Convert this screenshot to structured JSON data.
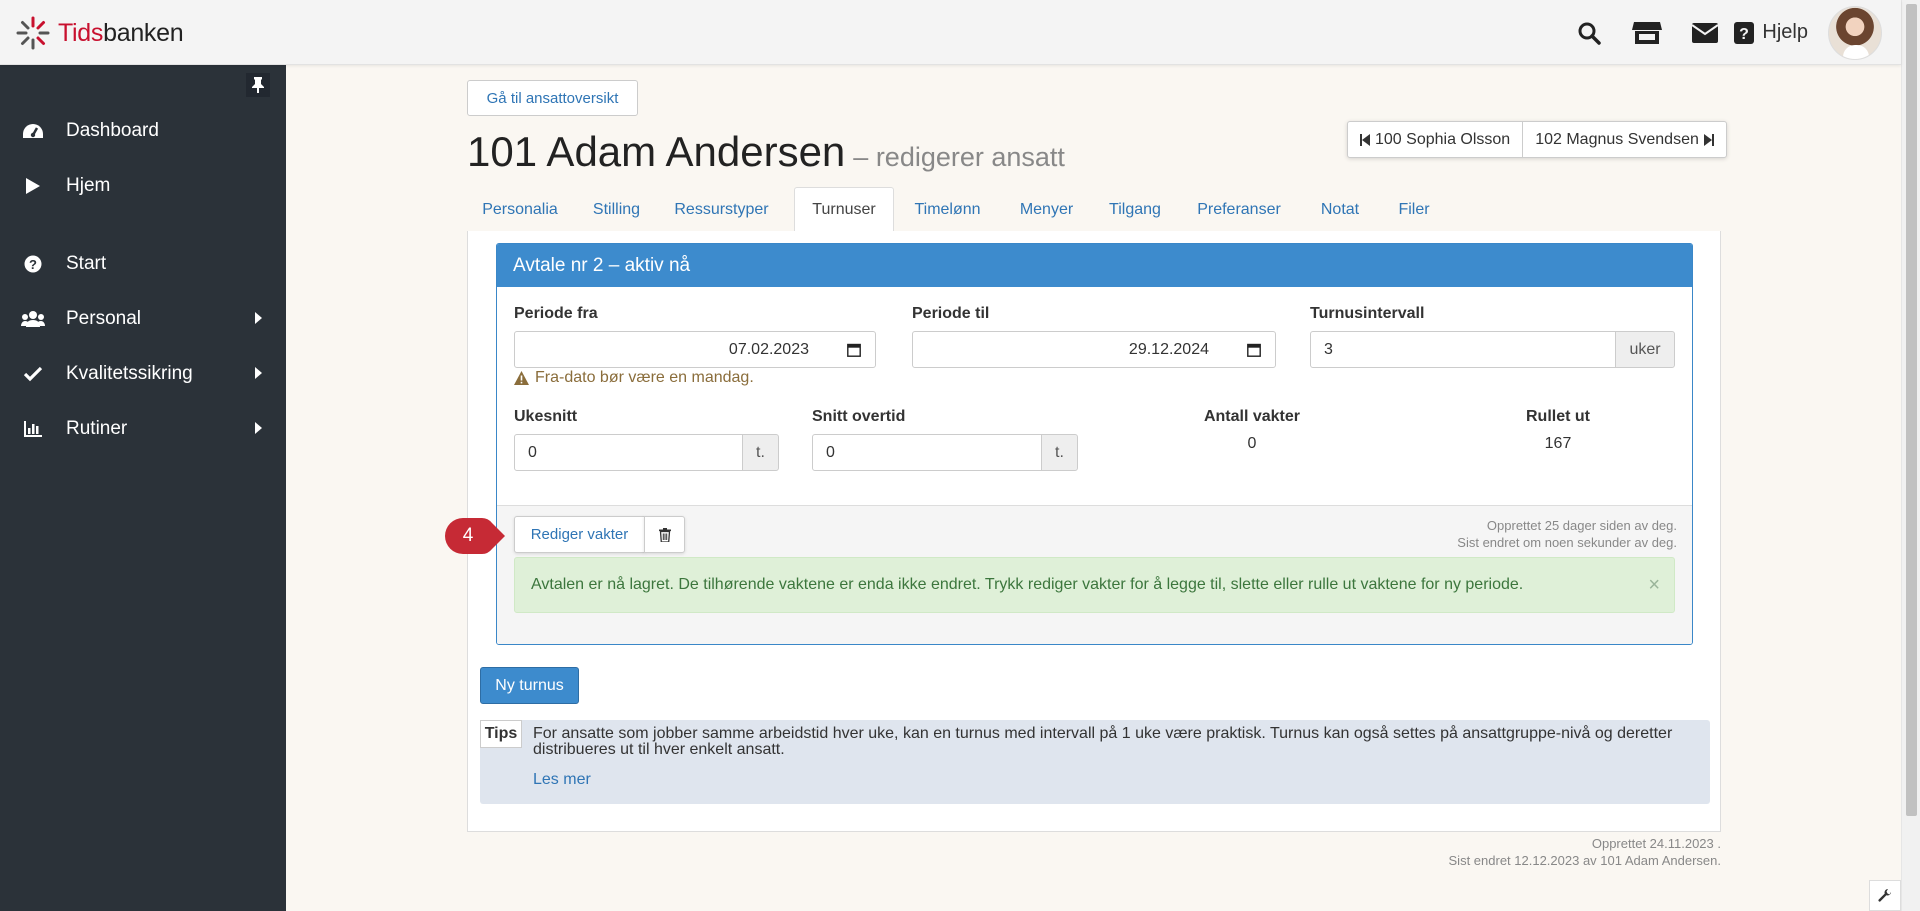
{
  "brand": {
    "part1": "Tids",
    "part2": "banken",
    "accent": "#c8102e"
  },
  "topbar": {
    "help_label": "Hjelp",
    "icons": [
      "search-icon",
      "store-icon",
      "mail-icon",
      "question-icon"
    ]
  },
  "sidebar": {
    "items": [
      {
        "label": "Dashboard",
        "icon": "dashboard-icon"
      },
      {
        "label": "Hjem",
        "icon": "play-icon"
      },
      {
        "label": "Start",
        "icon": "question-circle-icon"
      },
      {
        "label": "Personal",
        "icon": "users-icon"
      },
      {
        "label": "Kvalitetssikring",
        "icon": "check-icon"
      },
      {
        "label": "Rutiner",
        "icon": "bar-chart-icon"
      }
    ]
  },
  "main": {
    "back_button": "Gå til ansattoversikt",
    "title": "101 Adam Andersen",
    "subtitle": "– redigerer ansatt",
    "prev_employee": "100 Sophia Olsson",
    "next_employee": "102 Magnus Svendsen",
    "tabs": [
      "Personalia",
      "Stilling",
      "Ressurstyper",
      "Turnuser",
      "Timelønn",
      "Menyer",
      "Tilgang",
      "Preferanser",
      "Notat",
      "Filer"
    ],
    "active_tab": "Turnuser"
  },
  "agreement": {
    "header": "Avtale nr 2 – aktiv nå",
    "period_from_label": "Periode fra",
    "period_from_value": "07.02.2023",
    "period_to_label": "Periode til",
    "period_to_value": "29.12.2024",
    "interval_label": "Turnusintervall",
    "interval_value": "3",
    "interval_unit": "uker",
    "warning": "Fra-dato bør være en mandag.",
    "weekly_avg_label": "Ukesnitt",
    "weekly_avg_value": "0",
    "weekly_avg_unit": "t.",
    "overtime_label": "Snitt overtid",
    "overtime_value": "0",
    "overtime_unit": "t.",
    "shifts_count_label": "Antall vakter",
    "shifts_count_value": "0",
    "rolled_out_label": "Rullet ut",
    "rolled_out_value": "167",
    "edit_shifts_button": "Rediger vakter",
    "created_note": "Opprettet 25 dager siden av deg.",
    "modified_note": "Sist endret om noen sekunder av deg.",
    "alert": "Avtalen er nå lagret. De tilhørende vaktene er enda ikke endret. Trykk rediger vakter for å legge til, slette eller rulle ut vaktene for ny periode.",
    "alert_close": "×"
  },
  "step_badge": "4",
  "new_rotation_button": "Ny turnus",
  "tips": {
    "tag": "Tips",
    "text": "For ansatte som jobber samme arbeidstid hver uke, kan en turnus med intervall på 1 uke være praktisk. Turnus kan også settes på ansattgruppe-nivå og deretter distribueres ut til hver enkelt ansatt.",
    "link": "Les mer"
  },
  "footer": {
    "created": "Opprettet 24.11.2023 .",
    "modified": "Sist endret 12.12.2023 av 101 Adam Andersen."
  }
}
